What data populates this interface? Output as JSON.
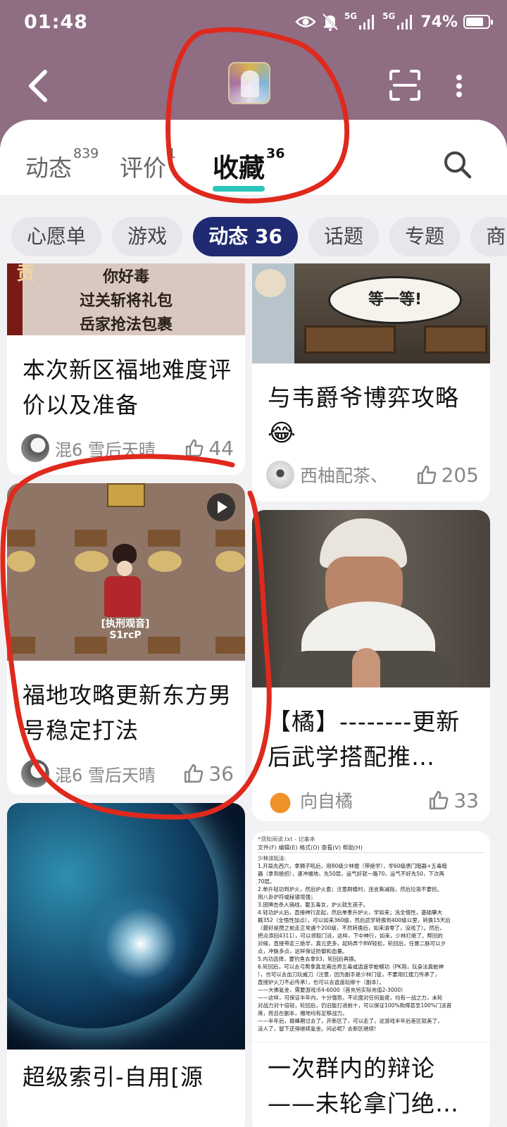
{
  "status_bar": {
    "time": "01:48",
    "net1": "5G",
    "net2": "5G",
    "battery": "74%"
  },
  "header": {
    "back_icon": "chevron-left-icon",
    "scan_icon": "scan-icon",
    "more_icon": "more-vertical-icon"
  },
  "tabs": [
    {
      "label": "动态",
      "count": "839"
    },
    {
      "label": "评价",
      "count": "1"
    },
    {
      "label": "收藏",
      "count": "36"
    }
  ],
  "chips": [
    "心愿单",
    "游戏",
    "动态 36",
    "话题",
    "专题",
    "商"
  ],
  "cards": [
    {
      "image_text": [
        "你好毒",
        "过关斩将礼包",
        "岳家抢法包裹"
      ],
      "title": "本次新区福地难度评价以及准备",
      "author": "混6 雪后天晴",
      "likes": "44"
    },
    {
      "image_text": "等一等!",
      "title": "与韦爵爷博弈攻略",
      "emoji": "😂",
      "author": "西柚配茶、",
      "likes": "205"
    },
    {
      "image_text": [
        "[执刑观音]",
        "S1rcP"
      ],
      "title": "福地攻略更新东方男号稳定打法",
      "author": "混6 雪后天晴",
      "likes": "36"
    },
    {
      "title": "【橘】--------更新后武学搭配推…",
      "author": "向自橘",
      "likes": "33"
    },
    {
      "title": "超级索引-自用[源"
    },
    {
      "notepad_header": "*须知阅读.txt - 记事本",
      "notepad_menu": "文件(F)  编辑(E)  格式(O)  查看(V)  帮助(H)",
      "notepad_lines": [
        "少林派玩法:",
        "1.开局先西六，拿狮子吼后，用80级少林棍（带绝学），学60级唐门暗器+五毒暗",
        "器（拿到绝招），速冲福地，先50层，运气好就一路70，运气不好先50，下次再",
        "70层。",
        "2.单升轻功到炉火，然后炉火套；注意刷楼时，违言乘减指，然后垃圾不要捡。",
        "用八卦炉符或秘银增强；",
        "3.团牌击杀人骑线，娶五毒女，炉火就生孩子。",
        "4.轻功炉火后，直接神行走起，然后单季升炉火，学如来；洗全悟性，基础攀大",
        "概352（全悟性加点），可以如来360级，然后武学转换到400级以里，转换15天后",
        "（最好是攒之前走正常遇个200级，不然转换后，如来清零了，没戏了）。然后，",
        "把点添回4311），可以领取门派，这样，下中神行，如来，少林打绝了。帮回的",
        "对候，直接带走三绝学，真元吏多，起码弄个8W轻松，轮回后，任督二脉可以夕",
        "点，冲脉多点，这样保证防御和血量。",
        "5.内功选择，要钓鱼去拿93，轮回后再换。",
        "6.轮回后，可以去弓帮拿真龙甫出师五毒或逍遥学蛤蟆功（PK用，玩身法真蛤神",
        "），也可以去血刀玩威刀（注意，因为副手是少林门徒，不要用红搜刀传承了，",
        "直接炉火刀不必传承），也可以去逍遥玩柳十（副本）。",
        "——大佛氪金，需要游戏币4-6000（首充另实际充值2-3000）",
        "——这样，可保证半年内，十分强势，不论面对任何氪佬，均有一战之力，未轮",
        "对战力对十倍轻，轮回后，仍旧能打进前十，可以保证100%购俾甚至100%门派首",
        "席，而且在副本，福地均有足够战力。",
        "——半年后，巅峰期过去了，开新区了，可以走了，这游戏半年后差区就美了，",
        "没人了，留下还得继续氪金。问必呢？去新区继续!"
      ],
      "title": "一次群内的辩论——未轮拿门绝…"
    }
  ],
  "colors": {
    "header_bg": "#8f6d83",
    "tab_underline": "#2bc6b9",
    "chip_active": "#1f2a72",
    "annotation": "#e0291d"
  }
}
